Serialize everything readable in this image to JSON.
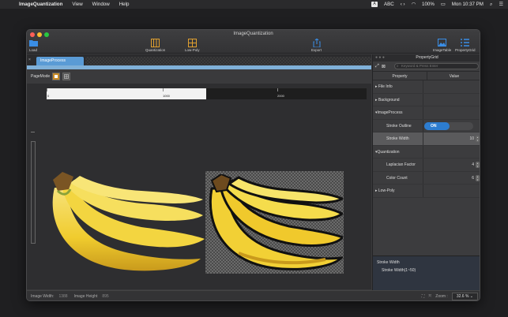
{
  "menubar": {
    "app_name": "ImageQuantization",
    "items": [
      "View",
      "Window",
      "Help"
    ],
    "input_badge": "A",
    "input_source": "ABC",
    "battery": "100%",
    "datetime": "Mon 10:37 PM"
  },
  "window": {
    "title": "ImageQuantization",
    "toolbar": {
      "load": "Load",
      "quantization": "Quantization",
      "low_poly": "Low-Poly",
      "export": "Export",
      "image_table": "ImageTable",
      "property_grid": "PropertyGrid"
    },
    "tab_label": "ImageProcess",
    "page_mode_label": "PageMode",
    "ruler": {
      "labels": [
        "0",
        "1000",
        "2000"
      ]
    },
    "status": {
      "width_label": "Image Width:",
      "width_value": "1388",
      "height_label": "Image Height",
      "height_value": "895",
      "zoom_label": "Zoom :",
      "zoom_value": "32.6 %"
    }
  },
  "property_grid": {
    "title": "PropertyGrid",
    "search_placeholder": "Keyword & Press Enter",
    "col_property": "Property",
    "col_value": "Value",
    "rows": [
      {
        "label": "File Info"
      },
      {
        "label": "Background"
      },
      {
        "label": "ImageProcess"
      },
      {
        "label": "Stroke Outline",
        "value": "ON"
      },
      {
        "label": "Stroke Width",
        "value": "10"
      },
      {
        "label": "Quantization"
      },
      {
        "label": "Laplacian Factor",
        "value": "4"
      },
      {
        "label": "Color Count",
        "value": "6"
      },
      {
        "label": "Low-Poly"
      }
    ],
    "description_title": "Stroke Width",
    "description_text": "Stroke Width(1~50)"
  },
  "colors": {
    "accent_blue": "#2d7dd0",
    "tab_blue": "#5a9bd5",
    "banana_yellow": "#f2d035"
  }
}
